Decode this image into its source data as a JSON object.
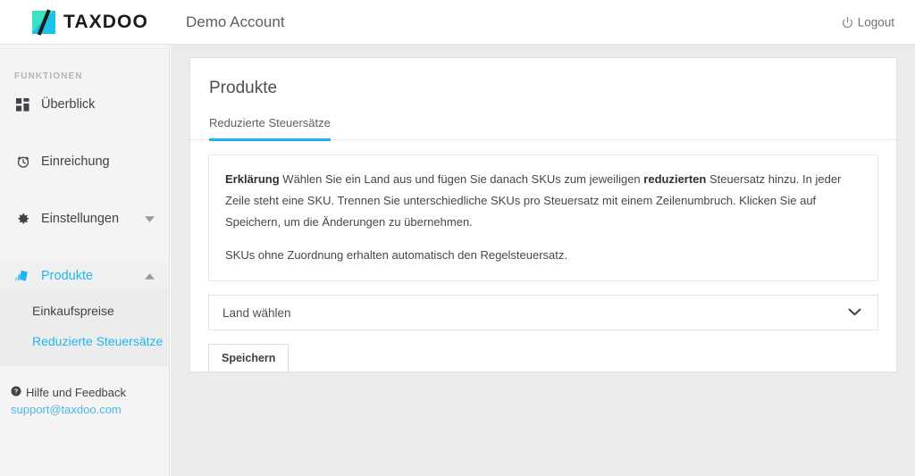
{
  "topbar": {
    "logo_text": "TAXDOO",
    "logo_icon": "taxdoo-logo-icon",
    "account_name": "Demo Account",
    "logout_label": "Logout",
    "logout_icon": "power-icon"
  },
  "sidebar": {
    "section_title": "FUNKTIONEN",
    "items": [
      {
        "label": "Überblick",
        "icon": "dashboard-grid-icon",
        "active": false,
        "caret": ""
      },
      {
        "label": "Einreichung",
        "icon": "clock-icon",
        "active": false,
        "caret": ""
      },
      {
        "label": "Einstellungen",
        "icon": "gear-icon",
        "active": false,
        "caret": "chevron-down-icon"
      },
      {
        "label": "Produkte",
        "icon": "boxes-icon",
        "active": true,
        "caret": "chevron-up-icon"
      }
    ],
    "submenu": [
      {
        "label": "Einkaufspreise",
        "active": false
      },
      {
        "label": "Reduzierte Steuersätze",
        "active": true
      }
    ],
    "help": {
      "icon": "question-circle-icon",
      "label": "Hilfe und Feedback",
      "email": "support@taxdoo.com"
    }
  },
  "main": {
    "card_title": "Produkte",
    "tabs": [
      {
        "label": "Reduzierte Steuersätze",
        "active": true
      }
    ],
    "explanation": {
      "line1_bold": "Erklärung",
      "line1_part1": " Wählen Sie ein Land aus und fügen Sie danach SKUs zum jeweiligen ",
      "line1_bold2": "reduzierten",
      "line1_part2": " Steuersatz hinzu. In jeder Zeile steht eine SKU. Trennen Sie unterschiedliche SKUs pro Steuersatz mit einem Zeilenumbruch. Klicken Sie auf Speichern, um die Änderungen zu übernehmen.",
      "paragraph2": "SKUs ohne Zuordnung erhalten automatisch den Regelsteuersatz."
    },
    "country_select": {
      "value": "Land wählen",
      "caret_icon": "chevron-down-icon"
    },
    "save_label": "Speichern"
  },
  "colors": {
    "accent": "#18b4f2",
    "sidebar_bg": "#f4f4f4",
    "submenu_bg": "#ececec",
    "main_bg": "#ebebeb",
    "card_bg": "#ffffff",
    "text": "#44474b",
    "muted": "#b4b4b4",
    "link": "#4db8e8"
  }
}
